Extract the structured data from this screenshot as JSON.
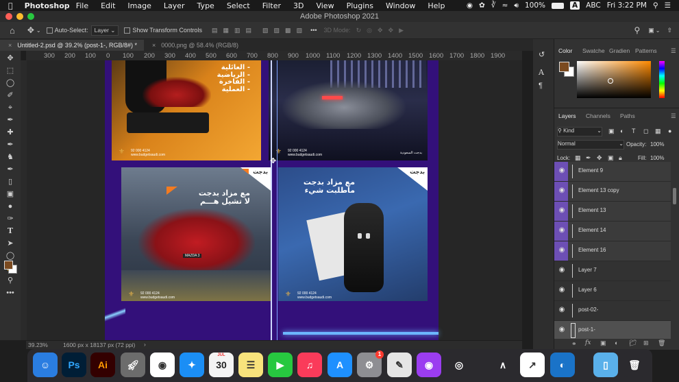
{
  "menubar": {
    "app": "Photoshop",
    "items": [
      "File",
      "Edit",
      "Image",
      "Layer",
      "Type",
      "Select",
      "Filter",
      "3D",
      "View",
      "Plugins",
      "Window",
      "Help"
    ],
    "battery": "100%",
    "input": "ABC",
    "input_badge": "A",
    "clock": "Fri 3:22 PM"
  },
  "window": {
    "title": "Adobe Photoshop 2021"
  },
  "options": {
    "auto_select_label": "Auto-Select:",
    "auto_select_value": "Layer",
    "show_transform_label": "Show Transform Controls",
    "mode_3d": "3D Mode:"
  },
  "tabs": [
    {
      "label": "Untitled-2.psd @ 39.2% (post-1-, RGB/8#) *"
    },
    {
      "label": "0000.png @ 58.4% (RGB/8)"
    }
  ],
  "ruler_labels": [
    "300",
    "200",
    "100",
    "0",
    "100",
    "200",
    "300",
    "400",
    "500",
    "600",
    "700",
    "800",
    "900",
    "1000",
    "1100",
    "1200",
    "1300",
    "1400",
    "1500",
    "1600",
    "1700",
    "1800",
    "1900"
  ],
  "canvas": {
    "tile1_text": [
      "- العائلية",
      "- الرياضية",
      "- الفاخرة",
      "- العملية"
    ],
    "tile3_text": [
      "مع مزاد بدجت",
      "لا تشيل هـــم"
    ],
    "tile4_text": [
      "مع مزاد بدجت",
      "ماطلبت شيء"
    ],
    "brand": "بدجت",
    "footer_phone": "92 000 4124",
    "footer_site": "www.budgetsaudi.com",
    "footer_brand": "بدجت السعودية",
    "car_plate": "MAZDA 3"
  },
  "status": {
    "zoom": "39.23%",
    "dims": "1600 px x 18137 px (72 ppi)",
    "arrow": "›"
  },
  "color_panel": {
    "tabs": [
      "Color",
      "Swatche",
      "Gradien",
      "Patterns"
    ],
    "fg": "#7b4a1f",
    "bg": "#ffffff",
    "picker_hue": "#ff8a00"
  },
  "layers_panel": {
    "tabs": [
      "Layers",
      "Channels",
      "Paths"
    ],
    "filter_kind": "Kind",
    "blend_mode": "Normal",
    "opacity_label": "Opacity:",
    "opacity": "100%",
    "lock_label": "Lock:",
    "fill_label": "Fill:",
    "fill": "100%",
    "layers": [
      {
        "name": "Element 9",
        "linked": true
      },
      {
        "name": "Element 13 copy",
        "linked": true
      },
      {
        "name": "Element 13",
        "linked": true
      },
      {
        "name": "Element 14",
        "linked": true
      },
      {
        "name": "Element 16",
        "linked": true
      },
      {
        "name": "Layer 7",
        "linked": false
      },
      {
        "name": "Layer 6",
        "linked": false
      },
      {
        "name": "post-02-",
        "linked": false
      },
      {
        "name": "post-1-",
        "linked": false,
        "selected": true
      }
    ]
  },
  "dock": {
    "items": [
      {
        "name": "finder-icon",
        "label": "",
        "bg": "#2a7de1"
      },
      {
        "name": "photoshop-icon",
        "label": "Ps",
        "bg": "#001e36"
      },
      {
        "name": "illustrator-icon",
        "label": "Ai",
        "bg": "#330000"
      },
      {
        "name": "launchpad-icon",
        "label": "",
        "bg": "#6c6c6c"
      },
      {
        "name": "chrome-icon",
        "label": "",
        "bg": "#ffffff"
      },
      {
        "name": "safari-icon",
        "label": "",
        "bg": "#1b8ef5"
      },
      {
        "name": "calendar-icon",
        "label": "30",
        "bg": "#f4f4f4",
        "sub": "JUL"
      },
      {
        "name": "notes-icon",
        "label": "",
        "bg": "#f8e37c"
      },
      {
        "name": "facetime-icon",
        "label": "",
        "bg": "#27c840"
      },
      {
        "name": "music-icon",
        "label": "",
        "bg": "#fa3b5a"
      },
      {
        "name": "appstore-icon",
        "label": "",
        "bg": "#1e90ff"
      },
      {
        "name": "system-preferences-icon",
        "label": "",
        "bg": "#8e8e93",
        "badge": "1"
      },
      {
        "name": "script-editor-icon",
        "label": "",
        "bg": "#e5e5e5"
      },
      {
        "name": "podcasts-icon",
        "label": "",
        "bg": "#9b3df0"
      },
      {
        "name": "blender-icon",
        "label": "",
        "bg": "#2b2a2e"
      },
      {
        "name": "compass-icon",
        "label": "",
        "bg": "#2b2a2e"
      },
      {
        "name": "activity-chart-icon",
        "label": "",
        "bg": "#ffffff"
      },
      {
        "name": "edge-icon",
        "label": "",
        "bg": "#1a73c8"
      },
      {
        "name": "folder-icon",
        "label": "",
        "bg": "#5ab0ea"
      },
      {
        "name": "trash-icon",
        "label": "",
        "bg": "#2b2a2e"
      }
    ]
  }
}
